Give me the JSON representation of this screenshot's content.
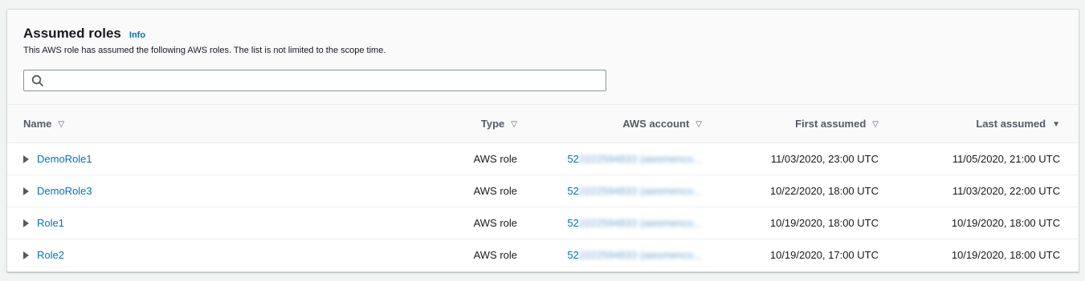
{
  "panel": {
    "title": "Assumed roles",
    "info_label": "Info",
    "description": "This AWS role has assumed the following AWS roles. The list is not limited to the scope time.",
    "search_placeholder": ""
  },
  "table": {
    "columns": [
      "Name",
      "Type",
      "AWS account",
      "First assumed",
      "Last assumed"
    ],
    "sort_icons": [
      "▽",
      "▽",
      "▽",
      "▽",
      "▼"
    ],
    "rows": [
      {
        "name": "DemoRole1",
        "type": "AWS role",
        "account_prefix": "52",
        "account_rest": "2222594833 (awsmenco...",
        "account_suffix": "...",
        "first": "11/03/2020, 23:00 UTC",
        "last": "11/05/2020, 21:00 UTC"
      },
      {
        "name": "DemoRole3",
        "type": "AWS role",
        "account_prefix": "52",
        "account_rest": "2222594833 (awsmenco...",
        "account_suffix": "...",
        "first": "10/22/2020, 18:00 UTC",
        "last": "11/03/2020, 22:00 UTC"
      },
      {
        "name": "Role1",
        "type": "AWS role",
        "account_prefix": "52",
        "account_rest": "2222594833 (awsmenco...",
        "account_suffix": "...",
        "first": "10/19/2020, 18:00 UTC",
        "last": "10/19/2020, 18:00 UTC"
      },
      {
        "name": "Role2",
        "type": "AWS role",
        "account_prefix": "52",
        "account_rest": "2222594833 (awsmenco...",
        "account_suffix": "...",
        "first": "10/19/2020, 17:00 UTC",
        "last": "10/19/2020, 18:00 UTC"
      }
    ]
  },
  "colors": {
    "link": "#0073bb",
    "header_bg": "#fafafa",
    "border": "#eaeded"
  },
  "icons": {
    "search": "search-icon",
    "expand": "caret-right-icon",
    "sort": "sort-icon"
  }
}
